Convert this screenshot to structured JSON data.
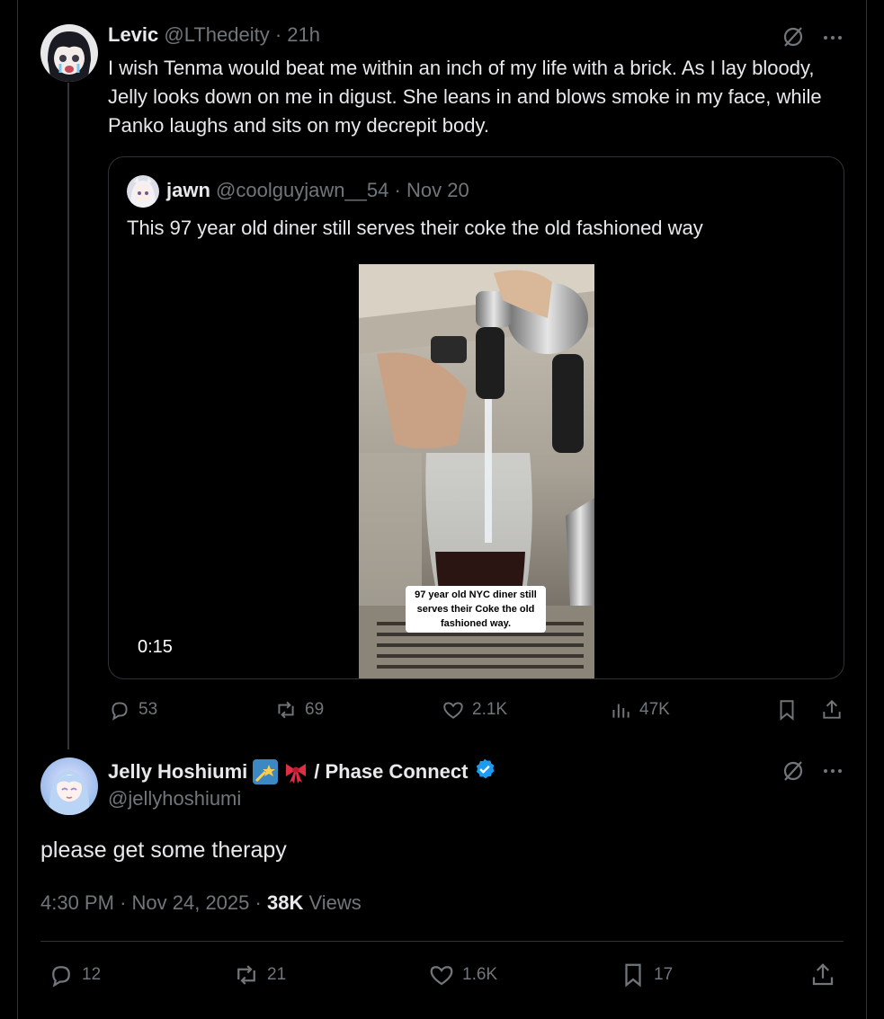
{
  "quoting_tweet": {
    "display_name": "Levic",
    "handle": "@LThedeity",
    "time": "21h",
    "text": "I wish Tenma would beat me within an inch of my life with a brick. As I lay bloody, Jelly looks down on me in digust. She leans in and blows smoke in my face, while Panko laughs and sits on my decrepit body.",
    "quoted": {
      "display_name": "jawn",
      "handle": "@coolguyjawn__54",
      "date": "Nov 20",
      "text": "This 97 year old diner still serves their coke the old fashioned way",
      "video_caption": "97 year old NYC diner still serves their Coke the old fashioned way.",
      "duration": "0:15"
    },
    "actions": {
      "replies": "53",
      "reposts": "69",
      "likes": "2.1K",
      "views": "47K"
    }
  },
  "main_tweet": {
    "display_name": "Jelly Hoshiumi",
    "name_suffix": "/ Phase Connect",
    "handle": "@jellyhoshiumi",
    "text": "please get some therapy",
    "time": "4:30 PM",
    "date": "Nov 24, 2025",
    "views_count": "38K",
    "views_label": "Views",
    "actions": {
      "replies": "12",
      "reposts": "21",
      "likes": "1.6K",
      "bookmarks": "17"
    }
  },
  "colors": {
    "background": "#000000",
    "text": "#e7e9ea",
    "muted": "#71767b",
    "border": "#2f3336",
    "verified": "#1d9bf0"
  }
}
